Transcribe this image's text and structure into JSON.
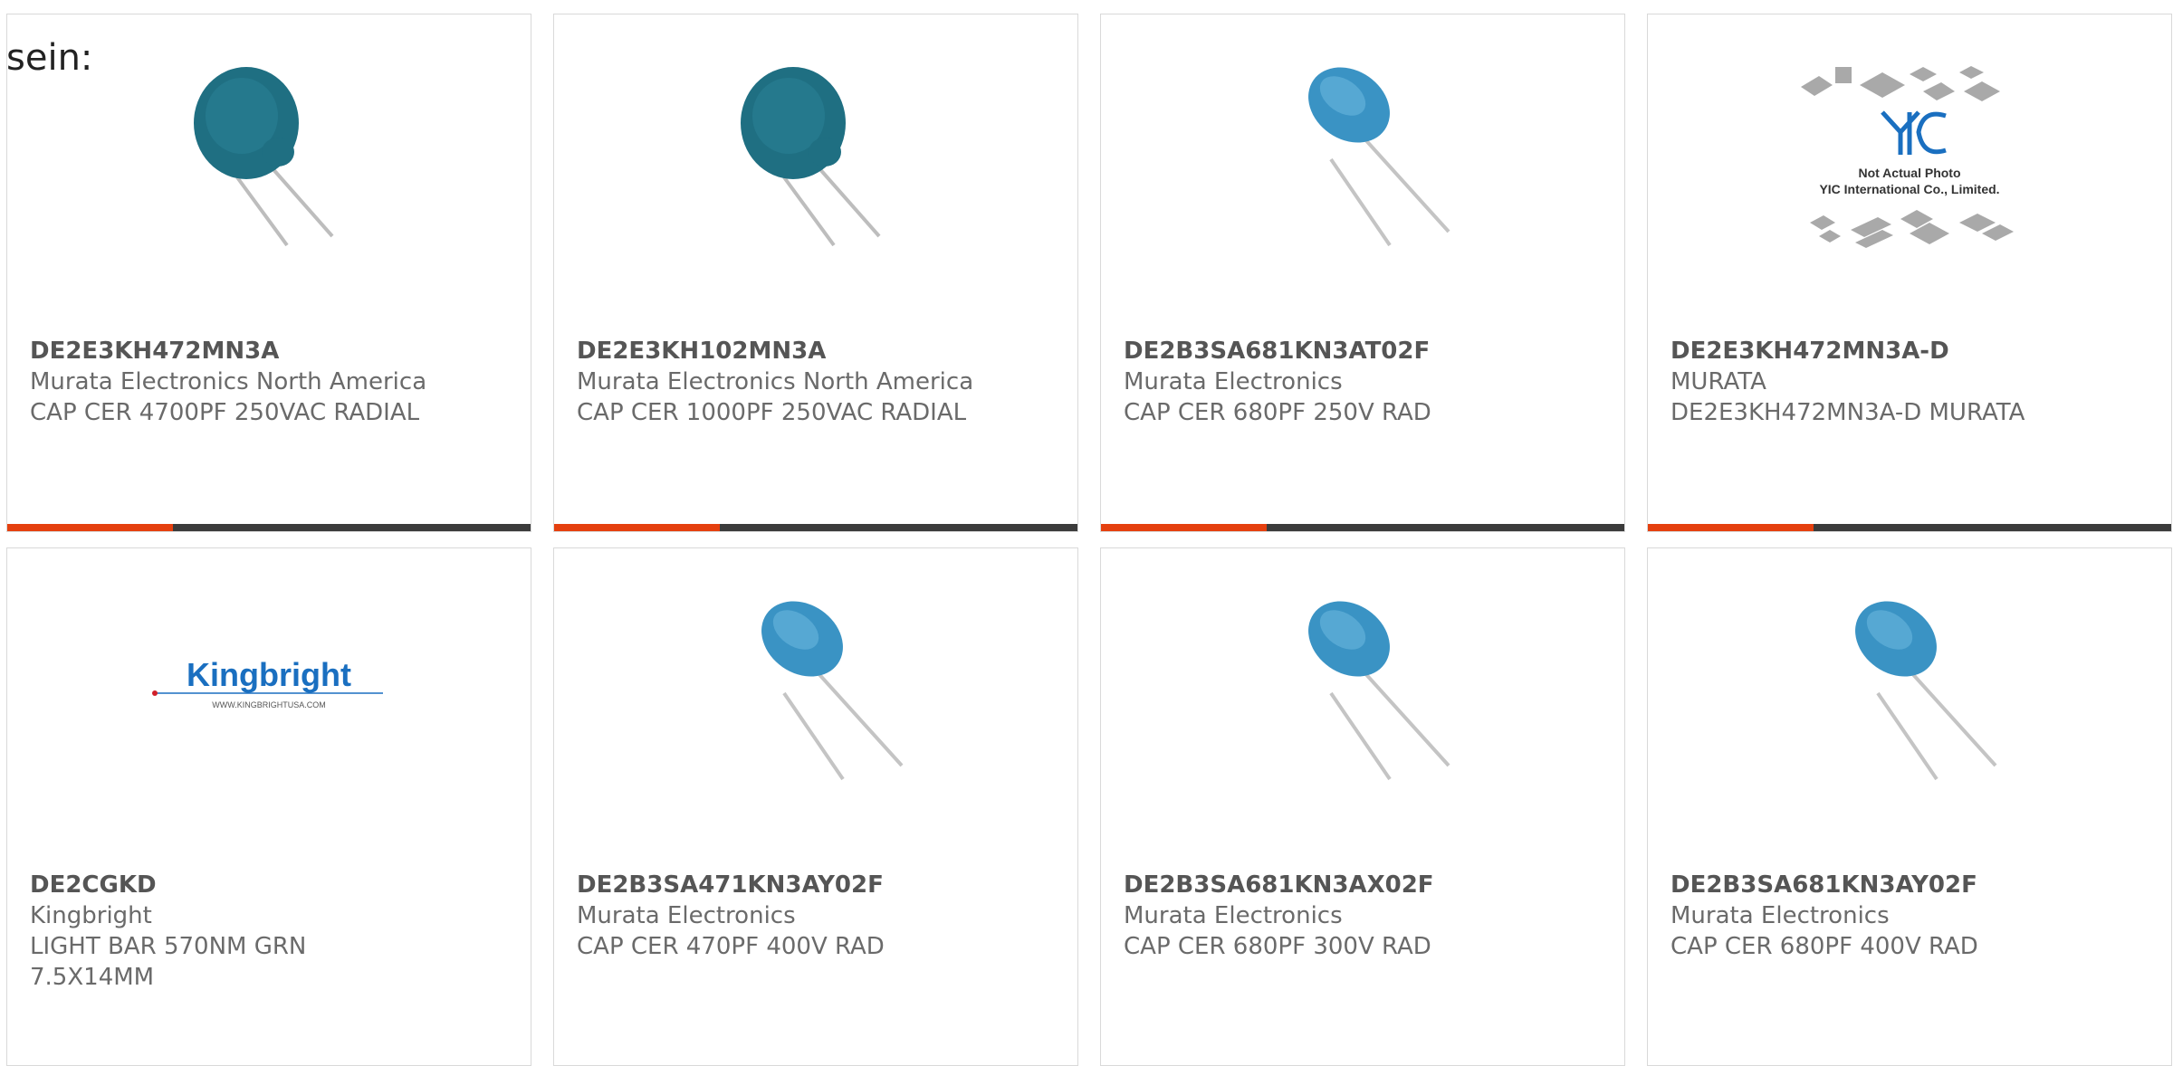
{
  "heading_fragment": "sein:",
  "colors": {
    "accent": "#e5400f",
    "bar": "#3b3b3b",
    "card_border": "#d9d9d9",
    "capacitor_dark": "#1f6f82",
    "capacitor_blue": "#3a93c4",
    "kingbright_blue": "#1a6fc0"
  },
  "products": [
    {
      "part_number": "DE2E3KH472MN3A",
      "manufacturer": "Murata Electronics North America",
      "description": "CAP CER 4700PF 250VAC RADIAL",
      "image": "dark-disc-capacitor"
    },
    {
      "part_number": "DE2E3KH102MN3A",
      "manufacturer": "Murata Electronics North America",
      "description": "CAP CER 1000PF 250VAC RADIAL",
      "image": "dark-disc-capacitor"
    },
    {
      "part_number": "DE2B3SA681KN3AT02F",
      "manufacturer": "Murata Electronics",
      "description": "CAP CER 680PF 250V RAD",
      "image": "blue-disc-capacitor"
    },
    {
      "part_number": "DE2E3KH472MN3A-D",
      "manufacturer": "MURATA",
      "description": "DE2E3KH472MN3A-D MURATA",
      "image": "yic-placeholder",
      "image_caption_line1": "Not Actual Photo",
      "image_caption_line2": "YIC International Co., Limited."
    },
    {
      "part_number": "DE2CGKD",
      "manufacturer": "Kingbright",
      "description": "LIGHT BAR 570NM GRN 7.5X14MM",
      "image": "kingbright-logo",
      "logo_text": "Kingbright",
      "logo_url": "WWW.KINGBRIGHTUSA.COM"
    },
    {
      "part_number": "DE2B3SA471KN3AY02F",
      "manufacturer": "Murata Electronics",
      "description": "CAP CER 470PF 400V RAD",
      "image": "blue-disc-capacitor"
    },
    {
      "part_number": "DE2B3SA681KN3AX02F",
      "manufacturer": "Murata Electronics",
      "description": "CAP CER 680PF 300V RAD",
      "image": "blue-disc-capacitor"
    },
    {
      "part_number": "DE2B3SA681KN3AY02F",
      "manufacturer": "Murata Electronics",
      "description": "CAP CER 680PF 400V RAD",
      "image": "blue-disc-capacitor"
    }
  ]
}
